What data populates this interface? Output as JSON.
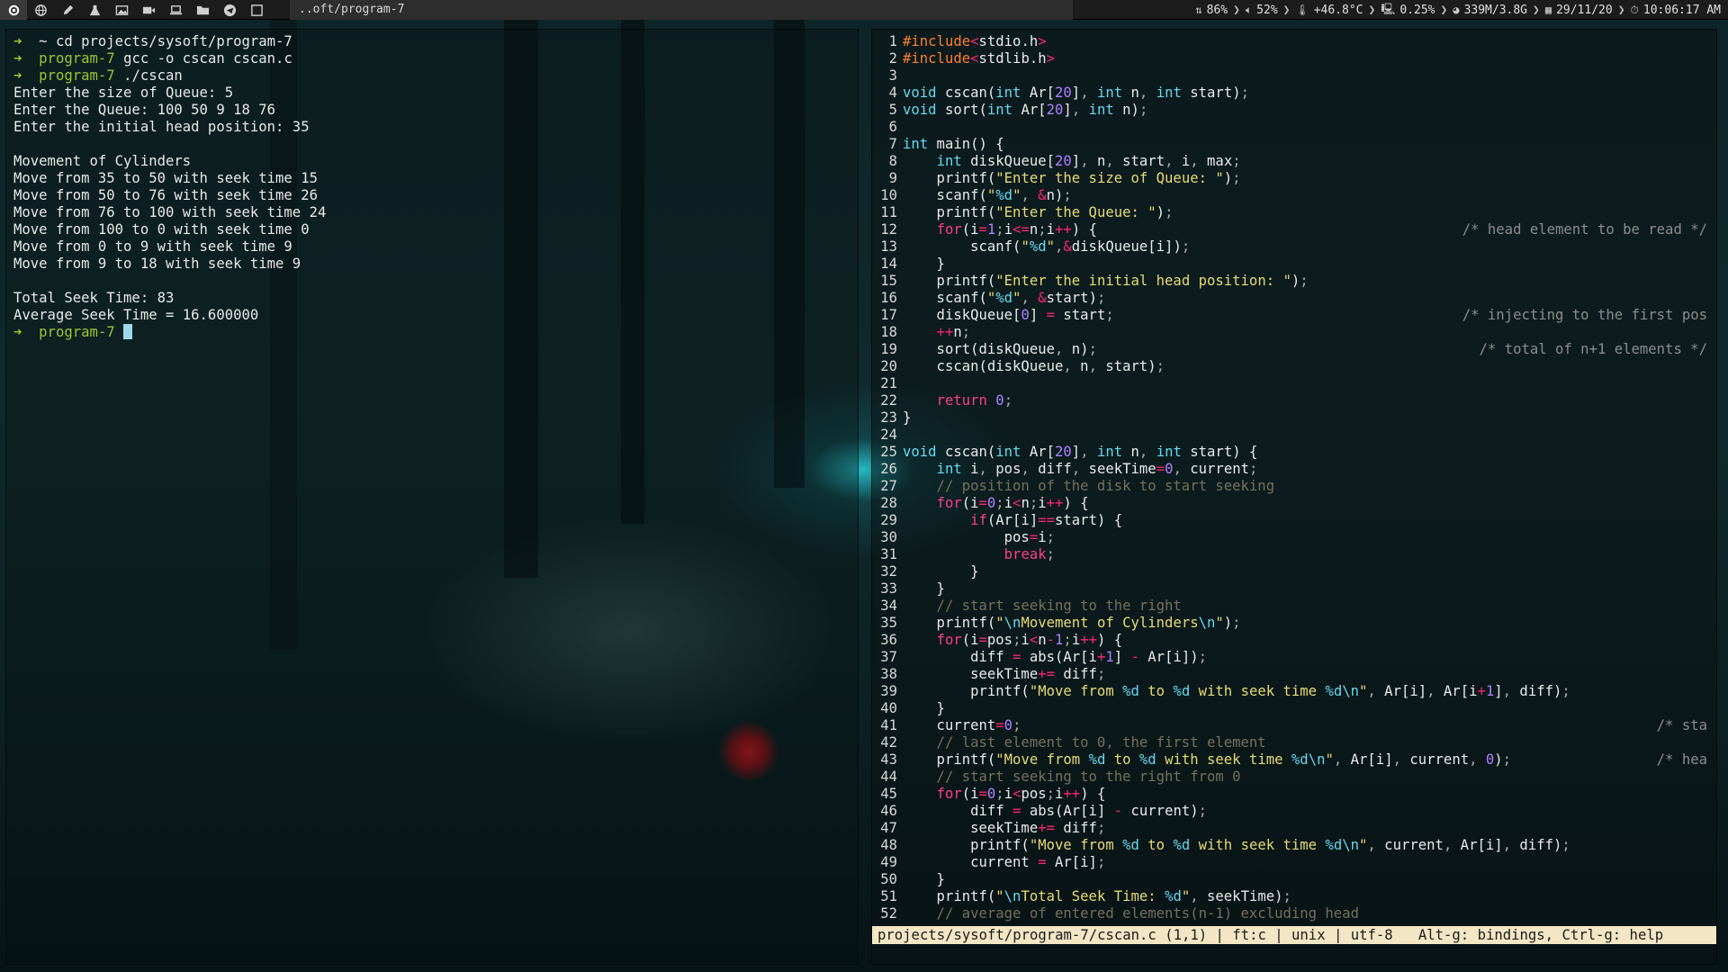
{
  "topbar": {
    "workspaces": [
      {
        "icon": "cog-icon"
      },
      {
        "icon": "globe-icon"
      },
      {
        "icon": "pen-icon"
      },
      {
        "icon": "flask-icon"
      },
      {
        "icon": "image-icon"
      },
      {
        "icon": "video-icon"
      },
      {
        "icon": "laptop-icon"
      },
      {
        "icon": "folder-icon"
      },
      {
        "icon": "telegram-icon"
      },
      {
        "icon": "window-icon"
      }
    ],
    "window_title": "..oft/program-7",
    "status": {
      "network": "86%",
      "volume": "52%",
      "temperature": "+46.8°C",
      "cpu": "0.25%",
      "memory": "339M/3.8G",
      "date": "29/11/20",
      "time": "10:06:17 AM"
    }
  },
  "terminal": {
    "lines": [
      {
        "type": "prompt",
        "arrow": "➜",
        "dir": "~",
        "cmd": "cd projects/sysoft/program-7"
      },
      {
        "type": "prompt",
        "arrow": "➜",
        "dir": "program-7",
        "cmd": "gcc -o cscan cscan.c"
      },
      {
        "type": "prompt",
        "arrow": "➜",
        "dir": "program-7",
        "cmd": "./cscan"
      },
      {
        "type": "out",
        "text": "Enter the size of Queue: 5"
      },
      {
        "type": "out",
        "text": "Enter the Queue: 100 50 9 18 76"
      },
      {
        "type": "out",
        "text": "Enter the initial head position: 35"
      },
      {
        "type": "out",
        "text": ""
      },
      {
        "type": "out",
        "text": "Movement of Cylinders"
      },
      {
        "type": "out",
        "text": "Move from 35 to 50 with seek time 15"
      },
      {
        "type": "out",
        "text": "Move from 50 to 76 with seek time 26"
      },
      {
        "type": "out",
        "text": "Move from 76 to 100 with seek time 24"
      },
      {
        "type": "out",
        "text": "Move from 100 to 0 with seek time 0"
      },
      {
        "type": "out",
        "text": "Move from 0 to 9 with seek time 9"
      },
      {
        "type": "out",
        "text": "Move from 9 to 18 with seek time 9"
      },
      {
        "type": "out",
        "text": ""
      },
      {
        "type": "out",
        "text": "Total Seek Time: 83"
      },
      {
        "type": "out",
        "text": "Average Seek Time = 16.600000"
      },
      {
        "type": "prompt",
        "arrow": "➜",
        "dir": "program-7",
        "cmd": "",
        "cursor": true
      }
    ]
  },
  "editor": {
    "lines": [
      {
        "n": "1",
        "code": "#include<stdio.h>"
      },
      {
        "n": "2",
        "code": "#include<stdlib.h>"
      },
      {
        "n": "3",
        "code": ""
      },
      {
        "n": "4",
        "code": "void cscan(int Ar[20], int n, int start);"
      },
      {
        "n": "5",
        "code": "void sort(int Ar[20], int n);"
      },
      {
        "n": "6",
        "code": ""
      },
      {
        "n": "7",
        "code": "int main() {"
      },
      {
        "n": "8",
        "code": "    int diskQueue[20], n, start, i, max;"
      },
      {
        "n": "9",
        "code": "    printf(\"Enter the size of Queue: \");"
      },
      {
        "n": "10",
        "code": "    scanf(\"%d\", &n);"
      },
      {
        "n": "11",
        "code": "    printf(\"Enter the Queue: \");"
      },
      {
        "n": "12",
        "code": "    for(i=1;i<=n;i++) {",
        "comment": "/* head element to be read */"
      },
      {
        "n": "13",
        "code": "        scanf(\"%d\",&diskQueue[i]);"
      },
      {
        "n": "14",
        "code": "    }"
      },
      {
        "n": "15",
        "code": "    printf(\"Enter the initial head position: \");"
      },
      {
        "n": "16",
        "code": "    scanf(\"%d\", &start);"
      },
      {
        "n": "17",
        "code": "    diskQueue[0] = start;",
        "comment": "/* injecting to the first pos"
      },
      {
        "n": "18",
        "code": "    ++n;"
      },
      {
        "n": "19",
        "code": "    sort(diskQueue, n);",
        "comment": "/* total of n+1 elements */"
      },
      {
        "n": "20",
        "code": "    cscan(diskQueue, n, start);"
      },
      {
        "n": "21",
        "code": ""
      },
      {
        "n": "22",
        "code": "    return 0;"
      },
      {
        "n": "23",
        "code": "}"
      },
      {
        "n": "24",
        "code": ""
      },
      {
        "n": "25",
        "code": "void cscan(int Ar[20], int n, int start) {"
      },
      {
        "n": "26",
        "code": "    int i, pos, diff, seekTime=0, current;"
      },
      {
        "n": "27",
        "code": "    // position of the disk to start seeking"
      },
      {
        "n": "28",
        "code": "    for(i=0;i<n;i++) {"
      },
      {
        "n": "29",
        "code": "        if(Ar[i]==start) {"
      },
      {
        "n": "30",
        "code": "            pos=i;"
      },
      {
        "n": "31",
        "code": "            break;"
      },
      {
        "n": "32",
        "code": "        }"
      },
      {
        "n": "33",
        "code": "    }"
      },
      {
        "n": "34",
        "code": "    // start seeking to the right"
      },
      {
        "n": "35",
        "code": "    printf(\"\\nMovement of Cylinders\\n\");"
      },
      {
        "n": "36",
        "code": "    for(i=pos;i<n-1;i++) {"
      },
      {
        "n": "37",
        "code": "        diff = abs(Ar[i+1] - Ar[i]);"
      },
      {
        "n": "38",
        "code": "        seekTime+= diff;"
      },
      {
        "n": "39",
        "code": "        printf(\"Move from %d to %d with seek time %d\\n\", Ar[i], Ar[i+1], diff);"
      },
      {
        "n": "40",
        "code": "    }"
      },
      {
        "n": "41",
        "code": "    current=0;",
        "comment": "/* sta"
      },
      {
        "n": "42",
        "code": "    // last element to 0, the first element"
      },
      {
        "n": "43",
        "code": "    printf(\"Move from %d to %d with seek time %d\\n\", Ar[i], current, 0);",
        "comment": "/* hea"
      },
      {
        "n": "44",
        "code": "    // start seeking to the right from 0"
      },
      {
        "n": "45",
        "code": "    for(i=0;i<pos;i++) {"
      },
      {
        "n": "46",
        "code": "        diff = abs(Ar[i] - current);"
      },
      {
        "n": "47",
        "code": "        seekTime+= diff;"
      },
      {
        "n": "48",
        "code": "        printf(\"Move from %d to %d with seek time %d\\n\", current, Ar[i], diff);"
      },
      {
        "n": "49",
        "code": "        current = Ar[i];"
      },
      {
        "n": "50",
        "code": "    }"
      },
      {
        "n": "51",
        "code": "    printf(\"\\nTotal Seek Time: %d\", seekTime);"
      },
      {
        "n": "52",
        "code": "    // average of entered elements(n-1) excluding head"
      }
    ],
    "statusline": "projects/sysoft/program-7/cscan.c (1,1) | ft:c | unix | utf-8   Alt-g: bindings, Ctrl-g: help"
  }
}
